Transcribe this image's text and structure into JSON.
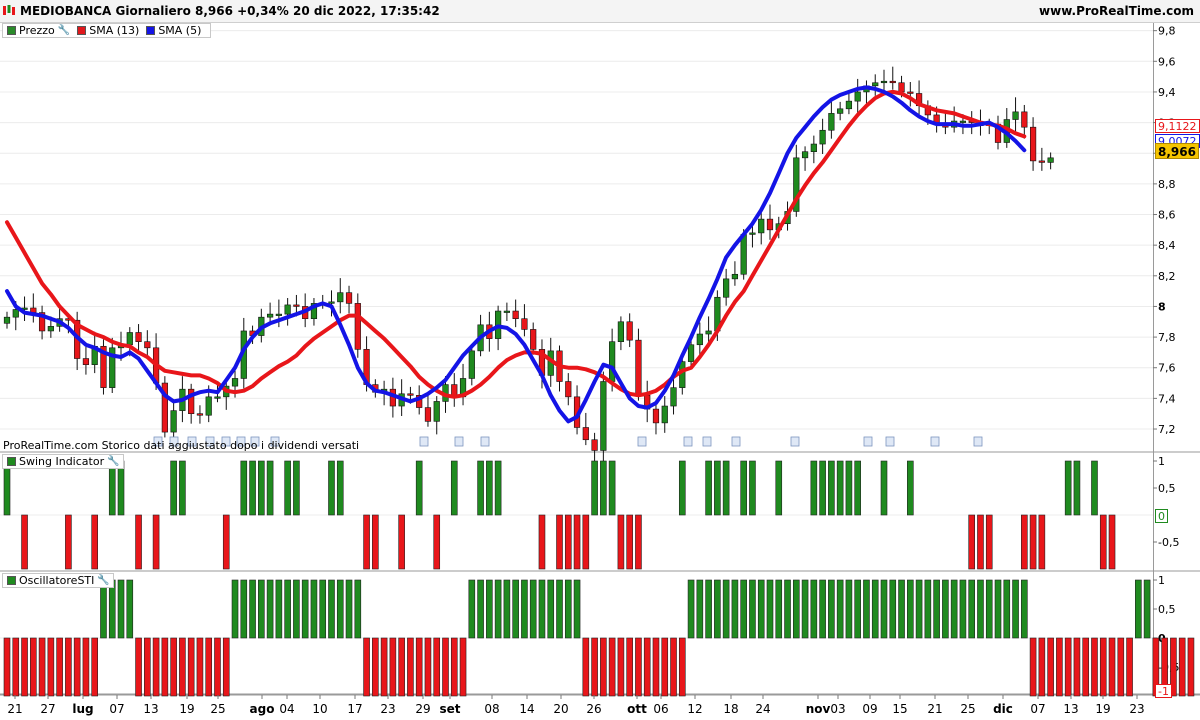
{
  "header": {
    "title": "MEDIOBANCA Giornaliero 8,966 +0,34% 20 dic 2022, 17:35:42",
    "site": "www.ProRealTime.com"
  },
  "legend_main": [
    {
      "label": "Prezzo",
      "color": "#2a8a2a"
    },
    {
      "label": "SMA (13)",
      "color": "#e0181c"
    },
    {
      "label": "SMA (5)",
      "color": "#1414e6"
    }
  ],
  "legend_swing": "Swing Indicator",
  "legend_osc": "OscillatoreSTI",
  "note": "ProRealTime.com Storico dati aggiustato dopo i dividendi versati",
  "price_tags": {
    "sma13": "9,1122",
    "sma5": "9,0072",
    "last": "8,966"
  },
  "swing_zero_tag": "0",
  "osc_min_tag": "-1",
  "colors": {
    "up": "#1f8a1f",
    "down": "#e8161a",
    "sma13": "#e8161a",
    "sma5": "#1414e6",
    "last_tag": "#f5c400"
  },
  "chart_data": [
    {
      "type": "candlestick",
      "title": "MEDIOBANCA Giornaliero",
      "y_ticks": [
        "9,8",
        "9,6",
        "9,4",
        "9,2",
        "9",
        "8,8",
        "8,6",
        "8,4",
        "8,2",
        "8",
        "7,8",
        "7,6",
        "7,4",
        "7,2"
      ],
      "ylim": [
        7.05,
        9.85
      ],
      "x_ticks": [
        "21",
        "27",
        "lug",
        "07",
        "13",
        "19",
        "25",
        "ago",
        "04",
        "10",
        "17",
        "23",
        "29",
        "set",
        "08",
        "14",
        "20",
        "26",
        "ott",
        "06",
        "12",
        "18",
        "24",
        "nov",
        "03",
        "09",
        "15",
        "21",
        "25",
        "dic",
        "07",
        "13",
        "19",
        "23"
      ],
      "close": [
        7.93,
        7.98,
        7.99,
        7.96,
        7.84,
        7.87,
        7.92,
        7.91,
        7.66,
        7.62,
        7.74,
        7.47,
        7.73,
        7.75,
        7.83,
        7.77,
        7.73,
        7.5,
        7.18,
        7.32,
        7.46,
        7.3,
        7.29,
        7.41,
        7.41,
        7.48,
        7.53,
        7.84,
        7.81,
        7.93,
        7.95,
        7.95,
        8.01,
        8.0,
        7.92,
        8.02,
        8.02,
        8.03,
        8.09,
        8.02,
        7.72,
        7.49,
        7.44,
        7.46,
        7.35,
        7.43,
        7.42,
        7.34,
        7.25,
        7.38,
        7.49,
        7.41,
        7.53,
        7.71,
        7.88,
        7.79,
        7.97,
        7.97,
        7.92,
        7.85,
        7.72,
        7.55,
        7.71,
        7.51,
        7.41,
        7.21,
        7.13,
        7.06,
        7.51,
        7.77,
        7.9,
        7.78,
        7.42,
        7.33,
        7.24,
        7.35,
        7.47,
        7.64,
        7.75,
        7.82,
        7.84,
        8.06,
        8.18,
        8.21,
        8.47,
        8.48,
        8.57,
        8.5,
        8.54,
        8.62,
        8.97,
        9.01,
        9.06,
        9.15,
        9.26,
        9.29,
        9.34,
        9.4,
        9.44,
        9.46,
        9.47,
        9.46,
        9.4,
        9.39,
        9.31,
        9.25,
        9.19,
        9.17,
        9.21,
        9.21,
        9.2,
        9.18,
        9.19,
        9.07,
        9.22,
        9.27,
        9.17,
        8.95,
        8.94,
        8.97
      ],
      "sma5": [
        8.1,
        8.0,
        7.96,
        7.95,
        7.94,
        7.92,
        7.9,
        7.86,
        7.8,
        7.75,
        7.73,
        7.7,
        7.68,
        7.67,
        7.7,
        7.66,
        7.58,
        7.5,
        7.42,
        7.38,
        7.39,
        7.42,
        7.44,
        7.45,
        7.44,
        7.52,
        7.6,
        7.72,
        7.8,
        7.86,
        7.89,
        7.91,
        7.93,
        7.95,
        7.97,
        8.0,
        8.02,
        8.0,
        7.88,
        7.75,
        7.6,
        7.5,
        7.45,
        7.44,
        7.42,
        7.4,
        7.38,
        7.4,
        7.43,
        7.47,
        7.52,
        7.6,
        7.68,
        7.74,
        7.8,
        7.84,
        7.87,
        7.86,
        7.82,
        7.75,
        7.65,
        7.55,
        7.42,
        7.32,
        7.25,
        7.28,
        7.39,
        7.51,
        7.62,
        7.6,
        7.5,
        7.4,
        7.35,
        7.34,
        7.37,
        7.45,
        7.55,
        7.68,
        7.8,
        7.93,
        8.05,
        8.18,
        8.32,
        8.4,
        8.47,
        8.54,
        8.63,
        8.74,
        8.87,
        9.0,
        9.1,
        9.17,
        9.24,
        9.3,
        9.35,
        9.38,
        9.4,
        9.42,
        9.43,
        9.42,
        9.4,
        9.37,
        9.33,
        9.28,
        9.24,
        9.21,
        9.19,
        9.19,
        9.19,
        9.18,
        9.18,
        9.19,
        9.2,
        9.17,
        9.13,
        9.08,
        9.02
      ],
      "sma13": [
        8.55,
        8.45,
        8.35,
        8.25,
        8.15,
        8.08,
        8.0,
        7.94,
        7.88,
        7.85,
        7.82,
        7.8,
        7.77,
        7.75,
        7.74,
        7.7,
        7.67,
        7.62,
        7.58,
        7.57,
        7.56,
        7.55,
        7.55,
        7.53,
        7.5,
        7.45,
        7.44,
        7.45,
        7.48,
        7.53,
        7.57,
        7.61,
        7.64,
        7.68,
        7.74,
        7.79,
        7.83,
        7.87,
        7.91,
        7.94,
        7.94,
        7.89,
        7.84,
        7.79,
        7.73,
        7.67,
        7.61,
        7.54,
        7.49,
        7.45,
        7.42,
        7.41,
        7.42,
        7.45,
        7.49,
        7.54,
        7.6,
        7.65,
        7.68,
        7.7,
        7.7,
        7.69,
        7.65,
        7.61,
        7.6,
        7.6,
        7.59,
        7.57,
        7.54,
        7.5,
        7.46,
        7.43,
        7.42,
        7.43,
        7.45,
        7.49,
        7.54,
        7.58,
        7.6,
        7.67,
        7.75,
        7.84,
        7.94,
        8.03,
        8.1,
        8.2,
        8.3,
        8.4,
        8.5,
        8.6,
        8.7,
        8.79,
        8.87,
        8.94,
        9.02,
        9.1,
        9.18,
        9.25,
        9.31,
        9.36,
        9.39,
        9.4,
        9.39,
        9.36,
        9.32,
        9.3,
        9.28,
        9.27,
        9.26,
        9.24,
        9.22,
        9.2,
        9.19,
        9.18,
        9.16,
        9.13,
        9.11
      ]
    },
    {
      "type": "bar",
      "title": "Swing Indicator",
      "y_ticks": [
        "1",
        "0,5",
        "-0,5"
      ],
      "ylim": [
        -1,
        1
      ],
      "values": [
        1,
        0,
        -1,
        0,
        0,
        0,
        0,
        -1,
        0,
        0,
        -1,
        0,
        1,
        1,
        0,
        -1,
        0,
        -1,
        0,
        1,
        1,
        0,
        0,
        0,
        0,
        -1,
        0,
        1,
        1,
        1,
        1,
        0,
        1,
        1,
        0,
        0,
        0,
        1,
        1,
        0,
        0,
        -1,
        -1,
        0,
        0,
        -1,
        0,
        1,
        0,
        -1,
        0,
        1,
        0,
        0,
        1,
        1,
        1,
        0,
        0,
        0,
        0,
        -1,
        0,
        -1,
        -1,
        -1,
        -1,
        1,
        1,
        1,
        -1,
        -1,
        -1,
        0,
        0,
        0,
        0,
        1,
        0,
        0,
        1,
        1,
        1,
        0,
        1,
        1,
        0,
        0,
        1,
        0,
        0,
        0,
        1,
        1,
        1,
        1,
        1,
        1,
        0,
        0,
        1,
        0,
        0,
        1,
        0,
        0,
        0,
        0,
        0,
        0,
        -1,
        -1,
        -1,
        0,
        0,
        0,
        -1,
        -1,
        -1,
        0,
        0,
        1,
        1,
        0,
        1,
        -1,
        -1,
        0
      ]
    },
    {
      "type": "bar",
      "title": "OscillatoreSTI",
      "y_ticks": [
        "1",
        "0,5",
        "0",
        "-0,5"
      ],
      "ylim": [
        -1,
        1
      ],
      "values": [
        -1,
        -1,
        -1,
        -1,
        -1,
        -1,
        -1,
        -1,
        -1,
        -1,
        -1,
        1,
        1,
        1,
        1,
        -1,
        -1,
        -1,
        -1,
        -1,
        -1,
        -1,
        -1,
        -1,
        -1,
        -1,
        1,
        1,
        1,
        1,
        1,
        1,
        1,
        1,
        1,
        1,
        1,
        1,
        1,
        1,
        1,
        -1,
        -1,
        -1,
        -1,
        -1,
        -1,
        -1,
        -1,
        -1,
        -1,
        -1,
        -1,
        1,
        1,
        1,
        1,
        1,
        1,
        1,
        1,
        1,
        1,
        1,
        1,
        1,
        -1,
        -1,
        -1,
        -1,
        -1,
        -1,
        -1,
        -1,
        -1,
        -1,
        -1,
        -1,
        1,
        1,
        1,
        1,
        1,
        1,
        1,
        1,
        1,
        1,
        1,
        1,
        1,
        1,
        1,
        1,
        1,
        1,
        1,
        1,
        1,
        1,
        1,
        1,
        1,
        1,
        1,
        1,
        1,
        1,
        1,
        1,
        1,
        1,
        1,
        1,
        1,
        1,
        1,
        -1,
        -1,
        -1,
        -1,
        -1,
        -1,
        -1,
        -1,
        -1,
        -1,
        -1,
        -1,
        1,
        1,
        -1,
        -1,
        -1,
        -1,
        -1
      ]
    }
  ]
}
